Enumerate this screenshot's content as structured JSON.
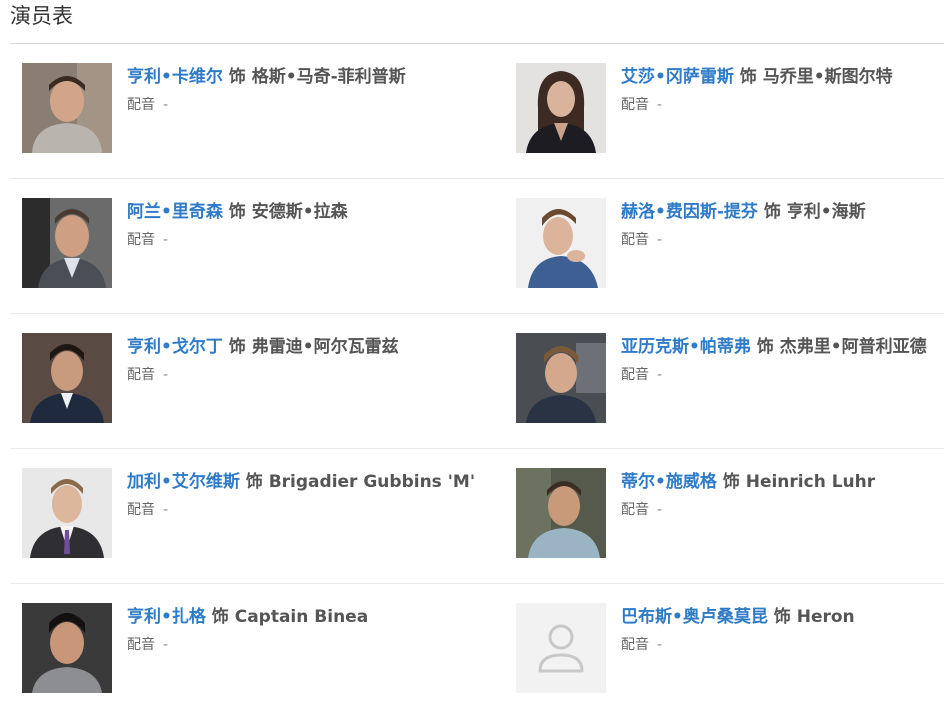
{
  "section": {
    "title": "演员表"
  },
  "labels": {
    "separator": "饰",
    "dub_label": "配音",
    "dub_value": "-"
  },
  "colors": {
    "link": "#2f7bc8",
    "text": "#555555",
    "rule": "#d8d8d8"
  },
  "cast": [
    {
      "actor": "亨利•卡维尔",
      "role": "格斯•马奇-菲利普斯",
      "photo": "portrait"
    },
    {
      "actor": "艾莎•冈萨雷斯",
      "role": "马乔里•斯图尔特",
      "photo": "portrait"
    },
    {
      "actor": "阿兰•里奇森",
      "role": "安德斯•拉森",
      "photo": "portrait"
    },
    {
      "actor": "赫洛•费因斯-提芬",
      "role": "亨利•海斯",
      "photo": "portrait"
    },
    {
      "actor": "亨利•戈尔丁",
      "role": "弗雷迪•阿尔瓦雷兹",
      "photo": "portrait"
    },
    {
      "actor": "亚历克斯•帕蒂弗",
      "role": "杰弗里•阿普利亚德",
      "photo": "portrait"
    },
    {
      "actor": "加利•艾尔维斯",
      "role": "Brigadier Gubbins 'M'",
      "photo": "portrait"
    },
    {
      "actor": "蒂尔•施威格",
      "role": "Heinrich Luhr",
      "photo": "portrait"
    },
    {
      "actor": "亨利•扎格",
      "role": "Captain Binea",
      "photo": "portrait"
    },
    {
      "actor": "巴布斯•奥卢桑莫昆",
      "role": "Heron",
      "photo": "placeholder-user-icon"
    }
  ]
}
